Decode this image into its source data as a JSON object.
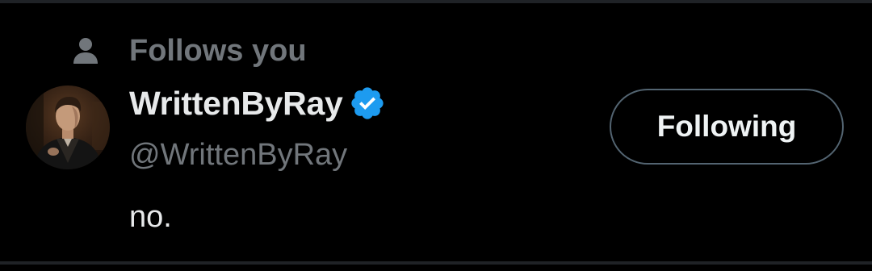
{
  "social_context": {
    "icon": "person-icon",
    "text": "Follows you"
  },
  "user": {
    "avatar_icon": "avatar-photo",
    "display_name": "WrittenByRay",
    "verified_icon": "verified-badge-icon",
    "handle": "@WrittenByRay",
    "bio": "no."
  },
  "actions": {
    "following_label": "Following"
  },
  "colors": {
    "background": "#000000",
    "primary_text": "#e7e9ea",
    "secondary_text": "#71767b",
    "verified_blue": "#1d9bf0",
    "button_border": "#536471",
    "divider": "#1f2226"
  }
}
